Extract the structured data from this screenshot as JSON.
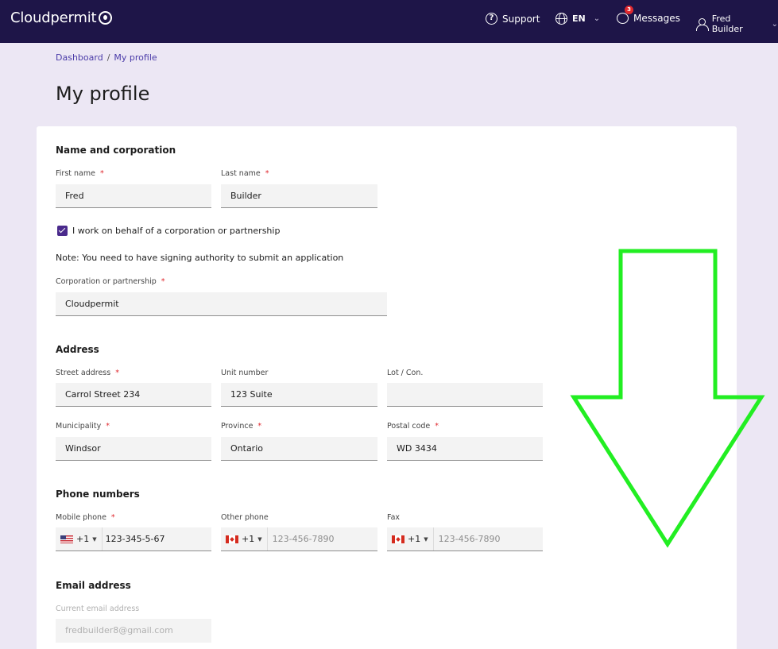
{
  "header": {
    "logo": "Cloudpermit",
    "support": "Support",
    "language": "EN",
    "messages": "Messages",
    "messages_badge": "3",
    "user": "Fred Builder"
  },
  "breadcrumb": {
    "dashboard": "Dashboard",
    "sep": "/",
    "current": "My profile"
  },
  "page_title": "My profile",
  "name_section": {
    "title": "Name and corporation",
    "first_name_label": "First name",
    "first_name": "Fred",
    "last_name_label": "Last name",
    "last_name": "Builder",
    "corp_checkbox_label": "I work on behalf of a corporation or partnership",
    "note": "Note: You need to have signing authority to submit an application",
    "corp_label": "Corporation or partnership",
    "corp_value": "Cloudpermit"
  },
  "address_section": {
    "title": "Address",
    "street_label": "Street address",
    "street": "Carrol Street 234",
    "unit_label": "Unit number",
    "unit": "123 Suite",
    "lot_label": "Lot / Con.",
    "lot": "",
    "municipality_label": "Municipality",
    "municipality": "Windsor",
    "province_label": "Province",
    "province": "Ontario",
    "postal_label": "Postal code",
    "postal": "WD 3434"
  },
  "phone_section": {
    "title": "Phone numbers",
    "mobile_label": "Mobile phone",
    "mobile_code": "+1",
    "mobile_value": "123-345-5-67",
    "other_label": "Other phone",
    "other_code": "+1",
    "other_placeholder": "123-456-7890",
    "fax_label": "Fax",
    "fax_code": "+1",
    "fax_placeholder": "123-456-7890"
  },
  "email_section": {
    "title": "Email address",
    "current_label": "Current email address",
    "current_value": "fredbuilder8@gmail.com"
  },
  "required_mark": "*",
  "colors": {
    "header_bg": "#1e1548",
    "page_bg": "#ece7f4",
    "accent": "#4a2a8c",
    "required": "#e0282e",
    "annotation_arrow": "#22ee22"
  }
}
